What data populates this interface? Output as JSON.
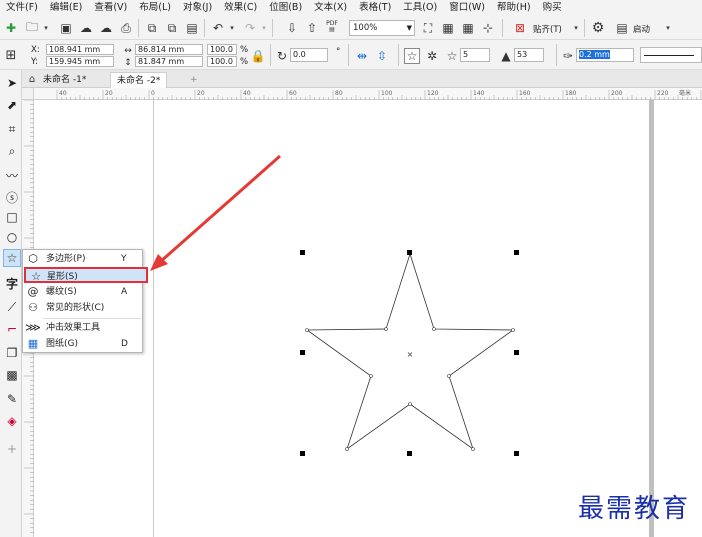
{
  "menu": [
    "文件(F)",
    "编辑(E)",
    "查看(V)",
    "布局(L)",
    "对象(J)",
    "效果(C)",
    "位图(B)",
    "文本(X)",
    "表格(T)",
    "工具(O)",
    "窗口(W)",
    "帮助(H)",
    "购买"
  ],
  "toolbar": {
    "zoom": "100%",
    "snap_label": "贴齐(T)",
    "launch_label": "启动",
    "pdf_label": "PDF"
  },
  "props": {
    "x_label": "X:",
    "y_label": "Y:",
    "x_value": "108.941 mm",
    "y_value": "159.945 mm",
    "w_value": "86.814 mm",
    "h_value": "81.847 mm",
    "scale_w": "100.0",
    "scale_h": "100.0",
    "pct": "%",
    "rotation": "0.0",
    "degree": "°",
    "points": "5",
    "sharpness": "53",
    "outline": "0.2 mm"
  },
  "tabs": [
    "未命名 -1*",
    "未命名 -2*"
  ],
  "add_tab": "+",
  "ruler": {
    "h_ticks": [
      "40",
      "20",
      "0",
      "20",
      "40",
      "60",
      "80",
      "100",
      "120",
      "140",
      "160",
      "180",
      "200",
      "220"
    ],
    "unit": "毫米"
  },
  "flyout": [
    {
      "label": "多边形(P)",
      "key": "Y",
      "icon": "polygon-icon"
    },
    {
      "label": "星形(S)",
      "key": "",
      "icon": "star-icon"
    },
    {
      "label": "螺纹(S)",
      "key": "A",
      "icon": "spiral-icon"
    },
    {
      "label": "常见的形状(C)",
      "key": "",
      "icon": "common-shapes-icon"
    },
    {
      "label": "冲击效果工具",
      "key": "",
      "icon": "impact-icon"
    },
    {
      "label": "图纸(G)",
      "key": "D",
      "icon": "graph-paper-icon"
    }
  ],
  "watermark": "最需教育",
  "colors": {
    "highlight_border": "#e0303a",
    "arrow": "#e53935",
    "watermark": "#1a2fa8",
    "selection": "#0078d7"
  }
}
